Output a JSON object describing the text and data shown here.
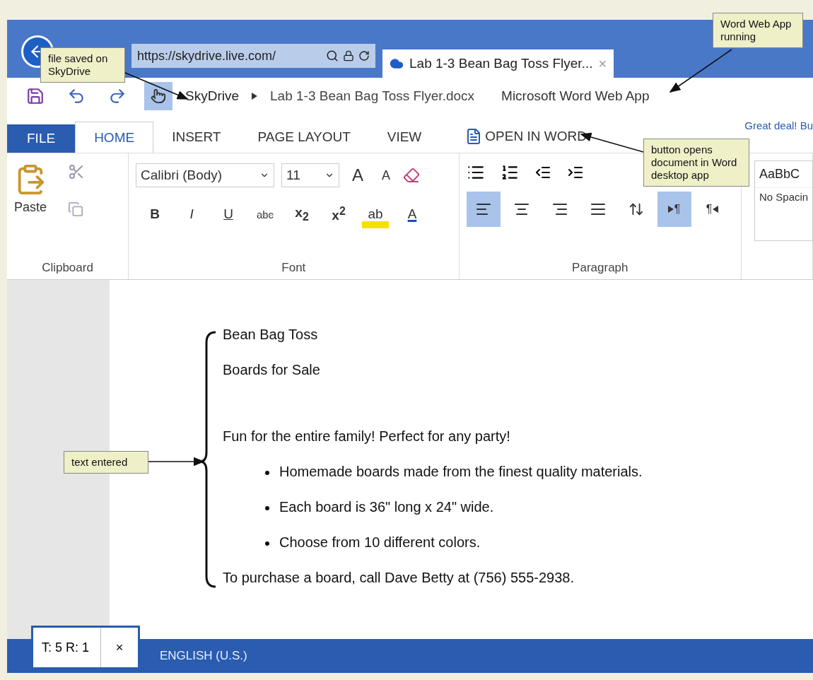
{
  "browser": {
    "address": "https://skydrive.live.com/",
    "tab_title": "Lab 1-3 Bean Bag Toss Flyer...",
    "tab_close": "×"
  },
  "app_bar": {
    "breadcrumb": [
      "SkyDrive",
      "Lab 1-3 Bean Bag Toss Flyer.docx"
    ],
    "app_name": "Microsoft Word Web App"
  },
  "tabs": [
    {
      "label": "FILE",
      "kind": "file",
      "selected": false
    },
    {
      "label": "HOME",
      "kind": "tab",
      "selected": true
    },
    {
      "label": "INSERT",
      "kind": "tab",
      "selected": false
    },
    {
      "label": "PAGE LAYOUT",
      "kind": "tab",
      "selected": false
    },
    {
      "label": "VIEW",
      "kind": "tab",
      "selected": false
    }
  ],
  "open_in_word": "OPEN IN WORD",
  "promo": "Great deal! Bu",
  "ribbon": {
    "clipboard": {
      "paste": "Paste",
      "label": "Clipboard"
    },
    "font": {
      "font_name": "Calibri (Body)",
      "font_size": "11",
      "grow": "A",
      "shrink": "A",
      "label": "Font",
      "format_buttons": [
        {
          "kind": "bold",
          "text": "B"
        },
        {
          "kind": "italic",
          "text": "I"
        },
        {
          "kind": "underline",
          "text": "U"
        },
        {
          "kind": "strike",
          "text": "abc"
        },
        {
          "kind": "sub",
          "text": "x$_{2}$"
        },
        {
          "kind": "sup",
          "text": "x$^{2}$"
        },
        {
          "kind": "highlight",
          "text": "ab"
        },
        {
          "kind": "color",
          "text": "A"
        }
      ]
    },
    "paragraph": {
      "label": "Paragraph",
      "alignment": [
        {
          "kind": "left",
          "selected": true
        },
        {
          "kind": "center",
          "selected": false
        },
        {
          "kind": "right",
          "selected": false
        },
        {
          "kind": "justify",
          "selected": false
        }
      ],
      "direction": [
        {
          "kind": "ltr",
          "text": "¶",
          "selected": true
        },
        {
          "kind": "rtl",
          "text": "¶",
          "selected": false
        }
      ]
    },
    "styles": {
      "preview": "AaBbC",
      "name": "No Spacin"
    }
  },
  "document": [
    {
      "kind": "line",
      "text": "Bean Bag Toss"
    },
    {
      "kind": "line",
      "text": "Boards for Sale"
    },
    {
      "kind": "gap"
    },
    {
      "kind": "line",
      "text": "Fun for the entire family! Perfect for any party!"
    },
    {
      "kind": "bullet",
      "text": "Homemade boards made from the finest quality materials."
    },
    {
      "kind": "bullet",
      "text": "Each board is 36\" long x 24\" wide."
    },
    {
      "kind": "bullet",
      "text": "Choose from 10 different colors."
    },
    {
      "kind": "line",
      "text": "To purchase a board, call Dave Betty at (756) 555-2938."
    }
  ],
  "counter": {
    "text": "T: 5 R: 1",
    "close": "×"
  },
  "status_bar": {
    "language": "ENGLISH (U.S.)"
  },
  "callouts": [
    {
      "text": "file saved on SkyDrive"
    },
    {
      "text": "Word Web App running"
    },
    {
      "text": "button opens document in Word desktop app"
    },
    {
      "text": "text entered"
    }
  ]
}
